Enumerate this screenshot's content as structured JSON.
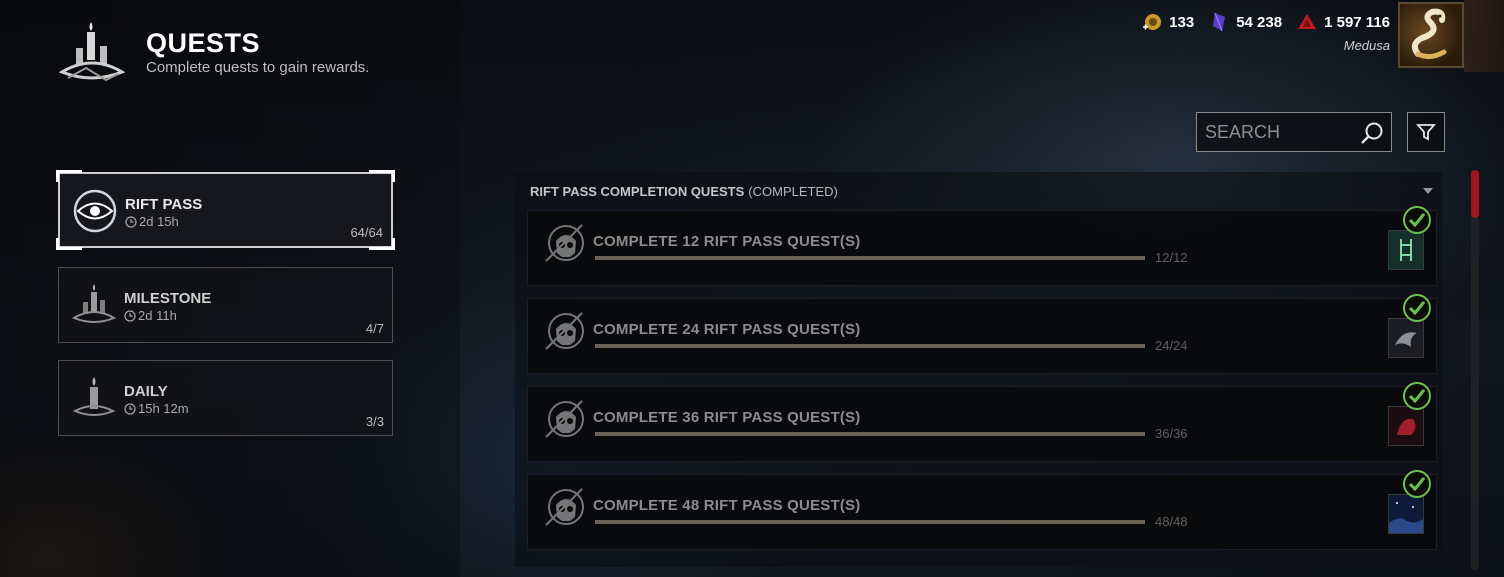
{
  "header": {
    "title": "QUESTS",
    "subtitle": "Complete quests to gain rewards.",
    "icon": "candles-icon"
  },
  "currency": {
    "bloodpoints_label": "133",
    "iridescent_shards_label": "54 238",
    "auric_cells_label": "1 597 116",
    "player_name": "Medusa"
  },
  "search": {
    "placeholder": "SEARCH"
  },
  "categories": [
    {
      "label": "RIFT PASS",
      "timer": "2d 15h",
      "count": "64/64",
      "icon": "rift-eye-icon",
      "selected": true
    },
    {
      "label": "MILESTONE",
      "timer": "2d 11h",
      "count": "4/7",
      "icon": "candles-icon",
      "selected": false
    },
    {
      "label": "DAILY",
      "timer": "15h 12m",
      "count": "3/3",
      "icon": "candle-icon",
      "selected": false
    }
  ],
  "section": {
    "title": "RIFT PASS COMPLETION QUESTS",
    "status": "(COMPLETED)"
  },
  "quests": [
    {
      "title": "COMPLETE 12 RIFT PASS QUEST(S)",
      "progress": "12/12",
      "completed": true,
      "reward_icon": "charm-reward-icon"
    },
    {
      "title": "COMPLETE 24 RIFT PASS QUEST(S)",
      "progress": "24/24",
      "completed": true,
      "reward_icon": "crow-reward-icon"
    },
    {
      "title": "COMPLETE 36 RIFT PASS QUEST(S)",
      "progress": "36/36",
      "completed": true,
      "reward_icon": "red-reward-icon"
    },
    {
      "title": "COMPLETE 48 RIFT PASS QUEST(S)",
      "progress": "48/48",
      "completed": true,
      "reward_icon": "night-reward-icon"
    }
  ],
  "colors": {
    "accent_red": "#a4141c",
    "check_green": "#6cc24a",
    "progress_fill": "#6b6459"
  }
}
